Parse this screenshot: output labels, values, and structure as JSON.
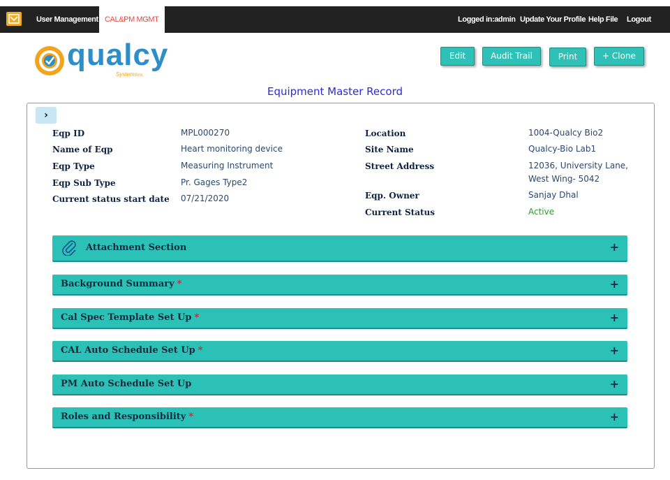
{
  "nav": {
    "items": [
      "User Management",
      "CAL&PM MGMT"
    ],
    "right": [
      "Logged in:admin",
      "Update Your Profile",
      "Help File",
      "Logout"
    ]
  },
  "logo": {
    "word": "qualcy",
    "sub": "Systems",
    "sub2": "Inc."
  },
  "toolbar": {
    "edit": "Edit",
    "audit": "Audit Trail",
    "print": "Print",
    "clone": "+ Clone"
  },
  "page_title": "Equipment Master Record",
  "toggle_glyph": "›",
  "left_fields": [
    {
      "label": "Eqp ID",
      "value": "MPL000270"
    },
    {
      "label": "Name of Eqp",
      "value": "Heart monitoring device"
    },
    {
      "label": "Eqp Type",
      "value": "Measuring Instrument"
    },
    {
      "label": "Eqp Sub Type",
      "value": "Pr. Gages Type2"
    },
    {
      "label": "Current status start date",
      "value": "07/21/2020"
    }
  ],
  "right_fields": [
    {
      "label": "Location",
      "value": "1004-Qualcy Bio2"
    },
    {
      "label": "Site Name",
      "value": "Qualcy-Bio Lab1"
    },
    {
      "label": "Street Address",
      "value": "12036, University Lane,",
      "value2": "West Wing- 5042"
    },
    {
      "label": "Eqp. Owner",
      "value": "Sanjay Dhal"
    },
    {
      "label": "Current Status",
      "value": "Active"
    }
  ],
  "sections": [
    {
      "title": "Attachment Section",
      "required": false,
      "star": ""
    },
    {
      "title": "Background Summary",
      "required": true,
      "star": "*"
    },
    {
      "title": "Cal Spec Template Set Up",
      "required": true,
      "star": "*"
    },
    {
      "title": "CAL Auto Schedule Set Up",
      "required": true,
      "star": "*"
    },
    {
      "title": "PM Auto Schedule Set Up",
      "required": false,
      "star": ""
    },
    {
      "title": "Roles and Responsibility",
      "required": true,
      "star": "*"
    }
  ],
  "expand_glyph": "+",
  "colors": {
    "navbar": "#222222",
    "accent": "#2cc1b7",
    "title_blue": "#2a2ae0",
    "active_tab": "#e64a3f",
    "status_active": "#2e9a2e"
  },
  "icons": [
    "home-icon",
    "chevron-right-icon",
    "paperclip-icon",
    "plus-icon"
  ]
}
